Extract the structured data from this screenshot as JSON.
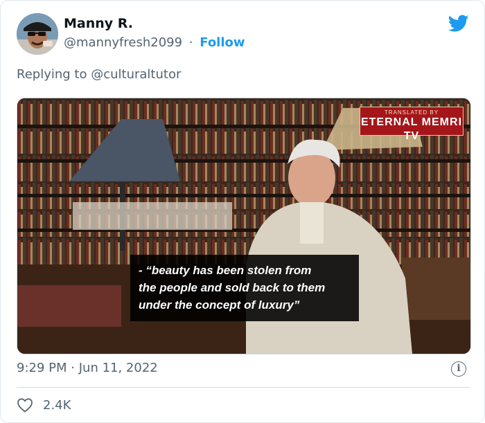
{
  "author": {
    "name": "Manny R.",
    "handle": "@mannyfresh2099",
    "separator": "·",
    "follow_label": "Follow"
  },
  "reply": {
    "prefix": "Replying to",
    "mention": "@culturaltutor"
  },
  "media": {
    "watermark_small": "TRANSLATED BY",
    "watermark_big": "ETERNAL MEMRI TV",
    "subtitle_lines": [
      "- “beauty has been stolen from",
      "the people and sold back to them",
      "under the concept of luxury”"
    ]
  },
  "meta": {
    "time": "9:29 PM",
    "separator": "·",
    "date": "Jun 11, 2022"
  },
  "engagement": {
    "likes": "2.4K"
  },
  "icons": {
    "brand": "twitter-bird-icon",
    "info": "info-icon",
    "like": "heart-icon"
  },
  "colors": {
    "accent": "#1d9bf0",
    "secondary_text": "#536471",
    "watermark_bg": "#a4161a"
  }
}
